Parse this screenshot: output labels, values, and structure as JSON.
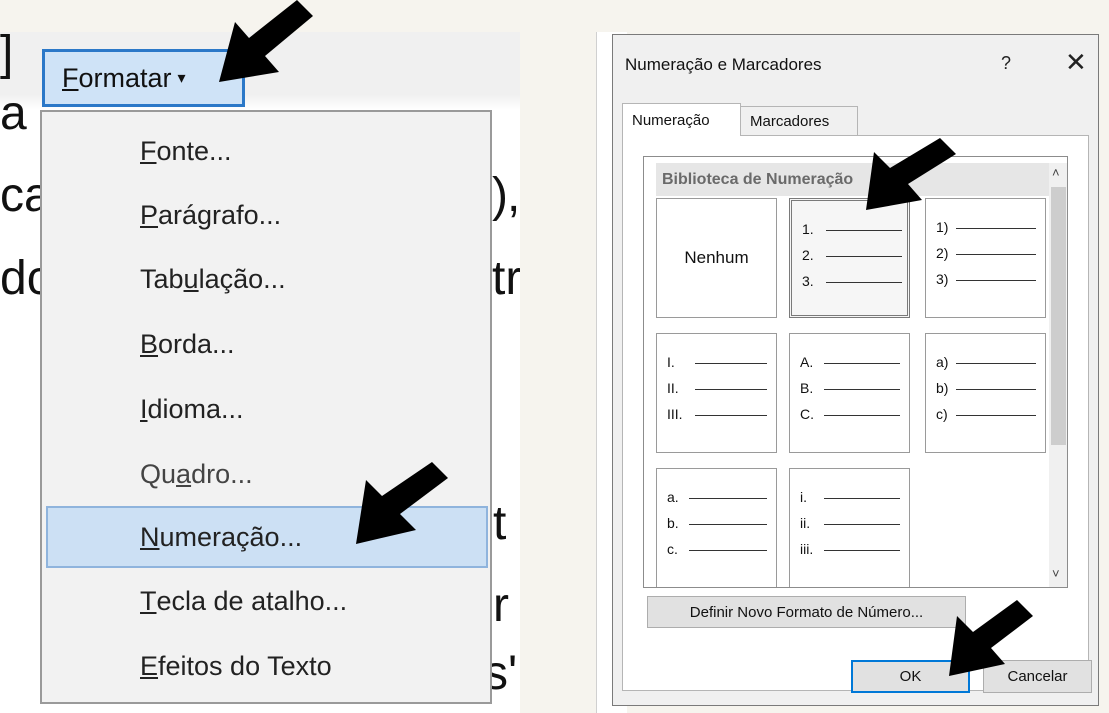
{
  "menu": {
    "title": "Formatar",
    "title_accel": "F",
    "title_rest": "ormatar",
    "caret": "▾",
    "items": [
      {
        "label": "Fonte...",
        "pre": "",
        "accel": "F",
        "post": "onte..."
      },
      {
        "label": "Parágrafo...",
        "pre": "",
        "accel": "P",
        "post": "arágrafo..."
      },
      {
        "label": "Tabulação...",
        "pre": "Tab",
        "accel": "u",
        "post": "lação..."
      },
      {
        "label": "Borda...",
        "pre": "",
        "accel": "B",
        "post": "orda..."
      },
      {
        "label": "Idioma...",
        "pre": "",
        "accel": "I",
        "post": "dioma..."
      },
      {
        "label": "Quadro...",
        "pre": "Qu",
        "accel": "a",
        "post": "dro..."
      },
      {
        "label": "Numeração...",
        "pre": "",
        "accel": "N",
        "post": "umeração..."
      },
      {
        "label": "Tecla de atalho...",
        "pre": "",
        "accel": "T",
        "post": "ecla de atalho..."
      },
      {
        "label": "Efeitos do Texto",
        "pre": "",
        "accel": "E",
        "post": "feitos do Texto"
      }
    ]
  },
  "doc_fragments": [
    "]",
    "a",
    "ca",
    "dc",
    ")",
    ",",
    "tr",
    "t",
    "r",
    "s'"
  ],
  "dialog": {
    "title": "Numeração e Marcadores",
    "help": "?",
    "close": "✕",
    "tabs": [
      "Numeração",
      "Marcadores"
    ],
    "gallery_header": "Biblioteca de Numeração",
    "none_label": "Nenhum",
    "formats": [
      [
        "1.",
        "2.",
        "3."
      ],
      [
        "1)",
        "2)",
        "3)"
      ],
      [
        "I.",
        "II.",
        "III."
      ],
      [
        "A.",
        "B.",
        "C."
      ],
      [
        "a)",
        "b)",
        "c)"
      ],
      [
        "a.",
        "b.",
        "c."
      ],
      [
        "i.",
        "ii.",
        "iii."
      ]
    ],
    "scroll_up": "˄",
    "scroll_down": "˅",
    "define_button": "Definir Novo Formato de Número...",
    "ok_button": "OK",
    "cancel_button": "Cancelar"
  }
}
